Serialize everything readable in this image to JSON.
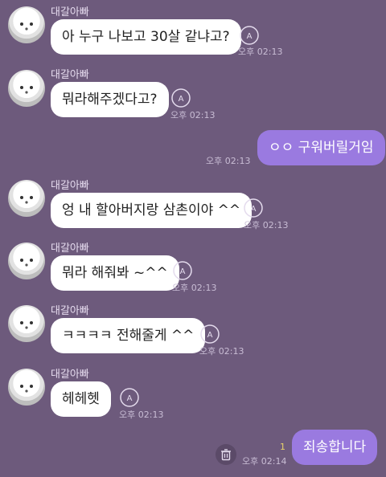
{
  "sender_name": "대갈아빠",
  "messages": [
    {
      "text": "아 누구 나보고 30살 같냐고?",
      "time": "오후 02:13"
    },
    {
      "text": "뭐라해주겠다고?",
      "time": "오후 02:13"
    },
    {
      "text": "ㅇㅇ 구워버릴거임",
      "time": "오후 02:13"
    },
    {
      "text": "엉 내 할아버지랑 삼촌이야 ^^",
      "time": "오후 02:13"
    },
    {
      "text": "뭐라 해줘봐 ~^^",
      "time": "오후 02:13"
    },
    {
      "text": "ㅋㅋㅋㅋ 전해줄게 ^^",
      "time": "오후 02:13"
    },
    {
      "text": "헤헤헷",
      "time": "오후 02:13"
    },
    {
      "text": "죄송합니다",
      "time": "오후 02:14",
      "unread": "1"
    }
  ],
  "colors": {
    "background": "#6d5a7c",
    "outgoing_bubble": "#9a7ae0",
    "incoming_bubble": "#ffffff"
  }
}
